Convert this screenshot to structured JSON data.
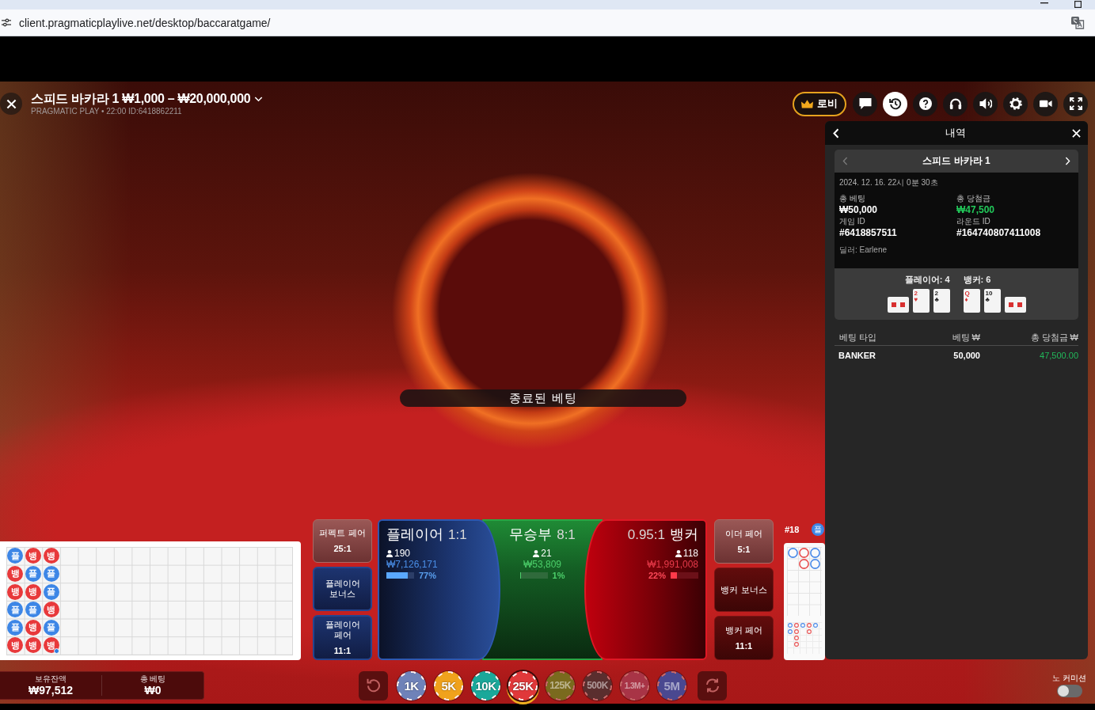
{
  "browser": {
    "url": "client.pragmaticplaylive.net/desktop/baccaratgame/"
  },
  "header": {
    "title": "스피드 바카라 1 ₩1,000 – ₩20,000,000",
    "subtitle": "PRAGMATIC PLAY • 22:00 ID:6418862211"
  },
  "toolbar": {
    "lobby": "로비",
    "tools": [
      {
        "kind": "chat",
        "selected": false
      },
      {
        "kind": "history",
        "selected": true
      },
      {
        "kind": "help",
        "selected": false
      },
      {
        "kind": "support",
        "selected": false
      },
      {
        "kind": "sound",
        "selected": false
      },
      {
        "kind": "settings",
        "selected": false
      },
      {
        "kind": "camera",
        "selected": false
      },
      {
        "kind": "fullscreen",
        "selected": false
      }
    ]
  },
  "status_banner": "종료된 베팅",
  "history": {
    "title": "내역",
    "game": "스피드 바카라 1",
    "prev_disabled": true,
    "next_disabled": false,
    "datetime": "2024. 12. 16. 22시 0분 30초",
    "fields": [
      {
        "label": "총 베팅",
        "value": "₩50,000",
        "kind": "plain"
      },
      {
        "label": "총 당첨금",
        "value": "₩47,500",
        "kind": "win"
      },
      {
        "label": "게임 ID",
        "value": "#6418857511",
        "kind": "plain"
      },
      {
        "label": "라운드 ID",
        "value": "#164740807411008",
        "kind": "plain"
      }
    ],
    "dealer": "딜러: Earlene",
    "hands": [
      {
        "label": "플레이어: 4",
        "cards": [
          {
            "rotated": true
          },
          {
            "rank": "2",
            "suit": "♥",
            "color": "#d83030",
            "rotated": false
          },
          {
            "rank": "2",
            "suit": "♣",
            "color": "#222222",
            "rotated": false
          }
        ]
      },
      {
        "label": "뱅커: 6",
        "cards": [
          {
            "rank": "Q",
            "suit": "♦",
            "color": "#d83030",
            "rotated": false
          },
          {
            "rank": "10",
            "suit": "♣",
            "color": "#222222",
            "rotated": false
          },
          {
            "rotated": true
          }
        ]
      }
    ],
    "columns": [
      "베팅 타입",
      "베팅 ₩",
      "총 당첨금 ₩"
    ],
    "rows": [
      {
        "type": "BANKER",
        "bet": "50,000",
        "win": "47,500.00"
      }
    ]
  },
  "betting": {
    "left": [
      {
        "label": "퍼펙트 페어",
        "odds": "25:1",
        "kind": "neutral"
      },
      {
        "label": "플레이어 보너스",
        "kind": "player"
      },
      {
        "label": "플레이어 페어",
        "odds": "11:1",
        "kind": "player"
      }
    ],
    "main": [
      {
        "kind": "player",
        "label": "플레이어",
        "odds": "1:1",
        "players": "190",
        "amount": "₩7,126,171",
        "percent": "77%",
        "level": 0.77
      },
      {
        "kind": "tie",
        "label": "무승부",
        "odds": "8:1",
        "players": "21",
        "amount": "₩53,809",
        "percent": "1%",
        "level": 0.01
      },
      {
        "kind": "banker",
        "label": "뱅커",
        "odds": "0.95:1",
        "players": "118",
        "amount": "₩1,991,008",
        "percent": "22%",
        "level": 0.22
      }
    ],
    "right": [
      {
        "label": "이더 페어",
        "odds": "5:1",
        "kind": "neutral"
      },
      {
        "label": "뱅커 보너스",
        "kind": "banker"
      },
      {
        "label": "뱅커 페어",
        "odds": "11:1",
        "kind": "banker"
      }
    ]
  },
  "bead_road": {
    "columns": [
      {
        "beads": [
          {
            "label": "플",
            "kind": "player",
            "player_pair": false
          },
          {
            "label": "뱅",
            "kind": "banker",
            "player_pair": false
          },
          {
            "label": "뱅",
            "kind": "banker",
            "player_pair": false
          },
          {
            "label": "플",
            "kind": "player",
            "player_pair": false
          },
          {
            "label": "플",
            "kind": "player",
            "player_pair": false
          },
          {
            "label": "뱅",
            "kind": "banker",
            "player_pair": false
          }
        ]
      },
      {
        "beads": [
          {
            "label": "뱅",
            "kind": "banker",
            "player_pair": false
          },
          {
            "label": "플",
            "kind": "player",
            "player_pair": false
          },
          {
            "label": "뱅",
            "kind": "banker",
            "player_pair": false
          },
          {
            "label": "플",
            "kind": "player",
            "player_pair": false
          },
          {
            "label": "뱅",
            "kind": "banker",
            "player_pair": false
          },
          {
            "label": "뱅",
            "kind": "banker",
            "player_pair": false
          }
        ]
      },
      {
        "beads": [
          {
            "label": "뱅",
            "kind": "banker",
            "player_pair": false
          },
          {
            "label": "플",
            "kind": "player",
            "player_pair": false
          },
          {
            "label": "플",
            "kind": "player",
            "player_pair": false
          },
          {
            "label": "뱅",
            "kind": "banker",
            "player_pair": false
          },
          {
            "label": "플",
            "kind": "player",
            "player_pair": false
          },
          {
            "label": "뱅",
            "kind": "banker",
            "player_pair": true
          }
        ]
      }
    ]
  },
  "big_road": {
    "round": "#18",
    "last": {
      "label": "플",
      "kind": "player"
    },
    "columns": [
      {
        "marks": [
          {
            "kind": "player"
          }
        ]
      },
      {
        "marks": [
          {
            "kind": "banker"
          },
          {
            "kind": "banker"
          }
        ]
      },
      {
        "marks": [
          {
            "kind": "player"
          },
          {
            "kind": "player"
          }
        ]
      }
    ],
    "small_road": [
      {
        "marks": [
          {
            "kind": "player"
          },
          {
            "kind": "player"
          }
        ]
      },
      {
        "marks": [
          {
            "kind": "banker"
          },
          {
            "kind": "banker"
          },
          {
            "kind": "banker"
          },
          {
            "kind": "banker"
          }
        ]
      },
      {
        "marks": [
          {
            "kind": "player"
          }
        ]
      },
      {
        "marks": [
          {
            "kind": "banker"
          },
          {
            "kind": "banker"
          }
        ]
      },
      {
        "marks": [
          {
            "kind": "player"
          }
        ]
      }
    ]
  },
  "controls": {
    "balance_label": "보유잔액",
    "balance": "₩97,512",
    "total_bet_label": "총 베팅",
    "total_bet": "₩0",
    "chips": [
      {
        "label": "1K",
        "color": "#6f82b8",
        "selected": false,
        "disabled": false
      },
      {
        "label": "5K",
        "color": "#f0a21c",
        "selected": false,
        "disabled": false
      },
      {
        "label": "10K",
        "color": "#1aa89a",
        "selected": false,
        "disabled": false
      },
      {
        "label": "25K",
        "color": "#e0383a",
        "selected": true,
        "disabled": false
      },
      {
        "label": "125K",
        "color": "#7a6a1e",
        "selected": false,
        "disabled": true
      },
      {
        "label": "500K",
        "color": "#5a2e2e",
        "selected": false,
        "disabled": true
      },
      {
        "label": "1.3M+",
        "color": "#a83446",
        "selected": false,
        "disabled": true
      },
      {
        "label": "5M",
        "color": "#4a4890",
        "selected": false,
        "disabled": true
      }
    ],
    "no_commission": {
      "label": "노 커미션",
      "on": false
    }
  }
}
